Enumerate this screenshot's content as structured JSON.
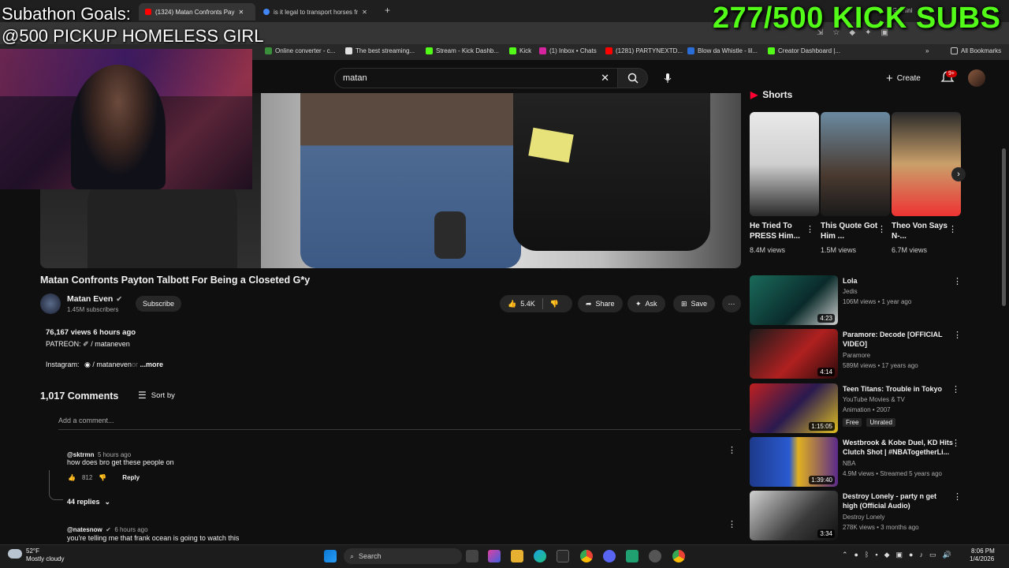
{
  "overlay": {
    "subathon_line1": "Subathon Goals:",
    "subathon_line2": "@500 PICKUP HOMELESS GIRL",
    "kick_subs": "277/500 KICK SUBS"
  },
  "browser": {
    "tabs": [
      {
        "label": "(1324) Matan Confronts Pay",
        "active": true
      },
      {
        "label": "is it legal to transport horses fr",
        "active": false
      }
    ],
    "profile_label": "Gemini",
    "bookmarks": [
      {
        "label": "Online converter - c...",
        "color": "#3a8f3a"
      },
      {
        "label": "The best streaming...",
        "color": "#e0e0e0"
      },
      {
        "label": "Stream - Kick Dashb...",
        "color": "#53fc18"
      },
      {
        "label": "Kick",
        "color": "#53fc18"
      },
      {
        "label": "(1) Inbox • Chats",
        "color": "#d6249f"
      },
      {
        "label": "(1281) PARTYNEXTD...",
        "color": "#ff0000"
      },
      {
        "label": "Blow da Whistle - lil...",
        "color": "#2a6dd6"
      },
      {
        "label": "Creator Dashboard |...",
        "color": "#53fc18"
      }
    ],
    "all_bookmarks": "All Bookmarks"
  },
  "youtube": {
    "search_value": "matan",
    "create_label": "Create",
    "notif_badge": "9+",
    "video": {
      "title": "Matan Confronts Payton Talbott For Being a Closeted G*y",
      "channel": "Matan Even",
      "subscribers": "1.45M subscribers",
      "subscribe_label": "Subscribe",
      "likes": "5.4K",
      "share_label": "Share",
      "ask_label": "Ask",
      "save_label": "Save"
    },
    "description": {
      "stats": "76,167 views  6 hours ago",
      "patreon": "PATREON:  ✐ / mataneven",
      "instagram_label": "Instagram:",
      "instagram_value": "◉ / mataneven",
      "instagram_fade": "or",
      "more": "...more"
    },
    "comments": {
      "count": "1,017 Comments",
      "sort_label": "Sort by",
      "add_placeholder": "Add a comment...",
      "items": [
        {
          "author": "@sktrmn",
          "time": "5 hours ago",
          "text": "how does bro get these people on",
          "likes": "812",
          "reply": "Reply",
          "replies": "44 replies"
        },
        {
          "author": "@natesnow",
          "time": "6 hours ago",
          "text": "you're telling me that frank ocean is going to watch this"
        }
      ]
    },
    "shorts": {
      "heading": "Shorts",
      "items": [
        {
          "title": "He Tried To PRESS Him...",
          "views": "8.4M views"
        },
        {
          "title": "This Quote Got Him ...",
          "views": "1.5M views"
        },
        {
          "title": "Theo Von Says N-...",
          "views": "6.7M views"
        }
      ]
    },
    "recommendations": [
      {
        "title": "Lola",
        "channel": "Jedis",
        "meta": "106M views • 1 year ago",
        "duration": "4:23"
      },
      {
        "title": "Paramore: Decode [OFFICIAL VIDEO]",
        "channel": "Paramore",
        "meta": "589M views • 17 years ago",
        "duration": "4:14"
      },
      {
        "title": "Teen Titans: Trouble in Tokyo",
        "channel": "YouTube Movies & TV",
        "meta": "Animation • 2007",
        "badge1": "Free",
        "badge2": "Unrated",
        "duration": "1:15:05"
      },
      {
        "title": "Westbrook & Kobe Duel, KD Hits Clutch Shot | #NBATogetherLi...",
        "channel": "NBA",
        "meta": "4.9M views • Streamed 5 years ago",
        "duration": "1:39:40"
      },
      {
        "title": "Destroy Lonely - party n get high (Official Audio)",
        "channel": "Destroy Lonely",
        "meta": "278K views • 3 months ago",
        "duration": "3:34"
      }
    ]
  },
  "taskbar": {
    "temp": "52°F",
    "weather": "Mostly cloudy",
    "search_label": "Search",
    "time": "8:06 PM",
    "date": "1/4/2026"
  }
}
